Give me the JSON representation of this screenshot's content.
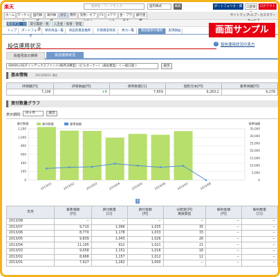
{
  "brand": {
    "logo_main": "楽天",
    "logo_accent": "証券"
  },
  "topbar": {
    "search_placeholder": "銘柄名・コードを入力",
    "search_select": "国内株式",
    "search_go": "検索",
    "portfolio_link": "ポートフォリオ・資産状況",
    "account_link": "口座情報",
    "logout_button": "ログアウト"
  },
  "nav": {
    "items": [
      "ホーム",
      "マーケット",
      "国内株式",
      "海外株式",
      "投信",
      "債券",
      "先物・オプション",
      "FX",
      "eワラント",
      "金・プラチナ",
      "銀行連携"
    ],
    "active_index": 4,
    "right_links": [
      "サイトマップ",
      "ヘルプ・カスタマーサービス"
    ]
  },
  "subnav1": {
    "items": [
      "資産状況・分析",
      "取引履歴・税金",
      "入出金・振替・管理"
    ],
    "active_index": 0
  },
  "subnav2": {
    "items": [
      "トップ",
      "ポートフォリオ",
      "保有商品一覧",
      "商品別資産推移",
      "外貨資産残高",
      "余力一覧",
      "資産推移の推移",
      "実現損益"
    ],
    "active_index": 6
  },
  "banner": "画面サンプル",
  "page": {
    "title": "投信運用状況",
    "help_link": "投信運用状況の見方",
    "help_icon": "?"
  },
  "tabs": {
    "inactive": "資産残高の推移",
    "active": "投信運用状況"
  },
  "fund": {
    "selected": "SMAM J-REITインデックスファンド(毎月決算型)（ビルオーナー）（再投資型）＜一般口座＞",
    "button": "表示"
  },
  "basic": {
    "heading": "基本情報",
    "as_of": "2013/08/21 現在",
    "headers": [
      "評価額[円]",
      "評価損益[円]",
      "保有数量[口]",
      "個別元本[円]",
      "基準価額[円]"
    ],
    "values": [
      "7,106",
      "+4",
      "7,659",
      "9,283.2",
      "9,278"
    ]
  },
  "graph": {
    "heading": "買付数量グラフ",
    "period_label": "表示期間：",
    "period_value": "36ヶ月",
    "period_button": "表示"
  },
  "chart_data": {
    "type": "bar",
    "left_axis_label": "買付数量",
    "right_axis_label": "基準価額",
    "left_ticks": [
      "1,200",
      "1,000",
      "800",
      "600",
      "400",
      "200",
      "0"
    ],
    "right_ticks": [
      "35,000",
      "30,000",
      "25,000",
      "20,000",
      "15,000",
      "10,000",
      "5,000",
      "0"
    ],
    "categories": [
      "2013/01",
      "2013/02",
      "2013/03",
      "2013/04",
      "2013/05",
      "2013/06",
      "2013/07",
      "2013/08"
    ],
    "series": [
      {
        "name": "買付数量",
        "type": "bar",
        "color": "#b7df6b",
        "values": [
          1242,
          1157,
          1151,
          991,
          1080,
          1061,
          1146,
          0
        ]
      },
      {
        "name": "基準価額",
        "type": "line",
        "color": "#4f8fd6",
        "values": [
          7927,
          8668,
          9058,
          11195,
          9839,
          8770,
          9710,
          0
        ]
      }
    ],
    "left_ylim": [
      0,
      1200
    ],
    "right_ylim": [
      0,
      35000
    ]
  },
  "page_number": "1",
  "history": {
    "headers": [
      "年月",
      "基準価額\n[円]",
      "買付数量\n[口]",
      "買付金額\n[円]",
      "分配金[円]\n再投資型",
      "解約金額\n[円]",
      "解約数量\n[口]"
    ],
    "rows": [
      [
        "2013/08",
        "--",
        "--",
        "--",
        "--",
        "--",
        "--"
      ],
      [
        "2013/07",
        "9,710",
        "1,066",
        "1,035",
        "35",
        "--",
        "--"
      ],
      [
        "2013/06",
        "8,770",
        "1,178",
        "1,033",
        "33",
        "--",
        "--"
      ],
      [
        "2013/05",
        "9,839",
        "1,043",
        "1,026",
        "26",
        "--",
        "--"
      ],
      [
        "2013/04",
        "11,195",
        "912",
        "1,021",
        "21",
        "--",
        "--"
      ],
      [
        "2013/03",
        "9,058",
        "1,151",
        "1,016",
        "16",
        "--",
        "--"
      ],
      [
        "2013/02",
        "8,668",
        "1,157",
        "1,012",
        "12",
        "--",
        "--"
      ],
      [
        "2013/01",
        "7,927",
        "1,262",
        "1,000",
        "--",
        "--",
        "--"
      ]
    ]
  }
}
